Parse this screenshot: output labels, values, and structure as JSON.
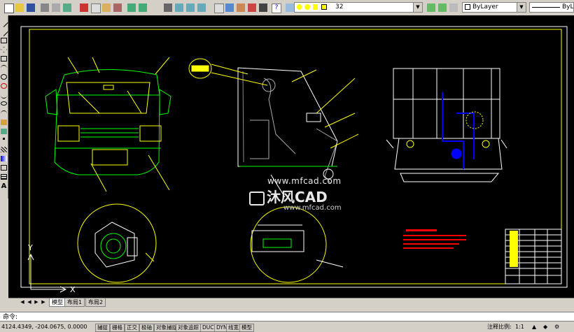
{
  "toolbar": {
    "layer_value": "32",
    "color_value": "ByLayer",
    "linetype_value": "ByLayer"
  },
  "watermark": {
    "url_top": "www.mfcad.com",
    "brand": "沐风CAD",
    "url_bottom": "www.mfcad.com"
  },
  "layout_tabs": [
    "模型",
    "布局1",
    "布局2"
  ],
  "command": {
    "prompt": "命令:"
  },
  "status": {
    "coords": "4124.4349, -204.0675, 0.0000",
    "buttons": [
      "捕捉",
      "栅格",
      "正交",
      "极轴",
      "对象捕捉",
      "对象追踪",
      "DUCS",
      "DYN",
      "线宽",
      "模型"
    ],
    "annotation_scale_label": "注释比例:",
    "annotation_scale_value": "1:1"
  },
  "ucs": {
    "x_label": "X",
    "y_label": "Y"
  },
  "colors": {
    "canvas_bg": "#000000",
    "drawing_green": "#00ff00",
    "drawing_yellow": "#ffff00",
    "drawing_white": "#ffffff",
    "drawing_red": "#ff0000",
    "drawing_blue": "#0000ff",
    "drawing_cyan": "#00ffff"
  }
}
